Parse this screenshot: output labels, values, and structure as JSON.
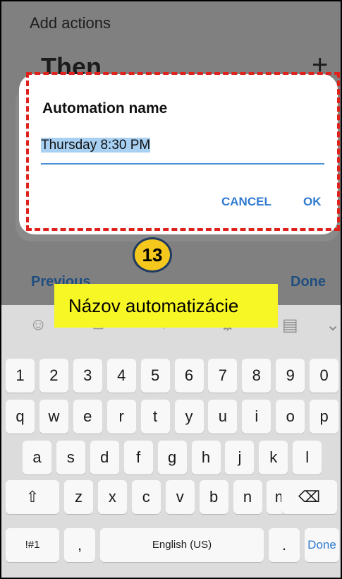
{
  "app": {
    "header": "Add actions",
    "section_title": "Then",
    "add_symbol": "+",
    "nav": {
      "previous": "Previous",
      "done": "Done"
    }
  },
  "dialog": {
    "title": "Automation name",
    "input_value": "Thursday 8:30 PM",
    "cancel": "CANCEL",
    "ok": "OK"
  },
  "annotation": {
    "step_number": "13",
    "callout_text": "Názov automatizácie",
    "highlight_color": "#e0221c",
    "badge_color": "#f4c81c",
    "callout_color": "#f7f726"
  },
  "keyboard": {
    "toolbar_icons": [
      "emoji-icon",
      "sticker-icon",
      "mic-icon",
      "settings-icon",
      "clipboard-icon",
      "collapse-icon"
    ],
    "numbers": [
      "1",
      "2",
      "3",
      "4",
      "5",
      "6",
      "7",
      "8",
      "9",
      "0"
    ],
    "row1": [
      "q",
      "w",
      "e",
      "r",
      "t",
      "y",
      "u",
      "i",
      "o",
      "p"
    ],
    "row2": [
      "a",
      "s",
      "d",
      "f",
      "g",
      "h",
      "j",
      "k",
      "l"
    ],
    "row3": [
      "z",
      "x",
      "c",
      "v",
      "b",
      "n",
      "m"
    ],
    "symbols": "!#1",
    "comma": ",",
    "space": "English (US)",
    "period": ".",
    "done": "Done",
    "shift": "⇧",
    "backspace": "⌫"
  }
}
